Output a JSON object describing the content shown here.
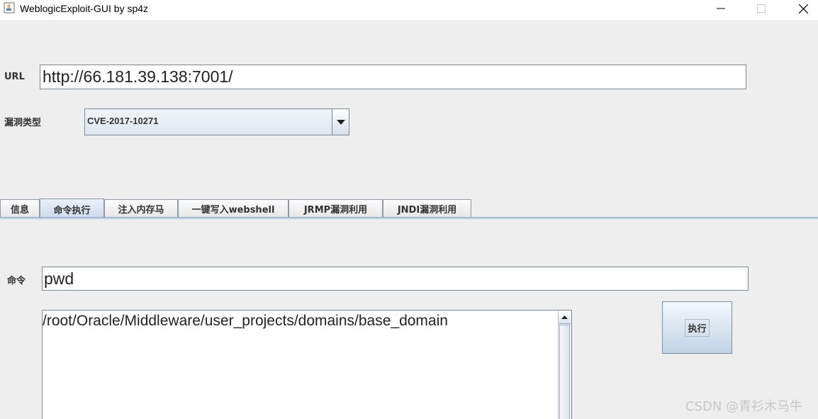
{
  "window": {
    "title": "WeblogicExploit-GUI by sp4z"
  },
  "form": {
    "url_label": "URL",
    "url_value": "http://66.181.39.138:7001/",
    "vuln_label": "漏洞类型",
    "vuln_selected": "CVE-2017-10271"
  },
  "tabs": [
    {
      "label": "信息"
    },
    {
      "label": "命令执行"
    },
    {
      "label": "注入内存马"
    },
    {
      "label": "一键写入webshell"
    },
    {
      "label": "JRMP漏洞利用"
    },
    {
      "label": "JNDI漏洞利用"
    }
  ],
  "active_tab": "命令执行",
  "command": {
    "label": "命令",
    "value": "pwd",
    "output": "/root/Oracle/Middleware/user_projects/domains/base_domain",
    "execute_label": "执行"
  },
  "watermark": "CSDN @青衫木马牛",
  "colors": {
    "background": "#eeeeee",
    "tab_active": "#c9d9ea",
    "border": "#7a8a99"
  }
}
